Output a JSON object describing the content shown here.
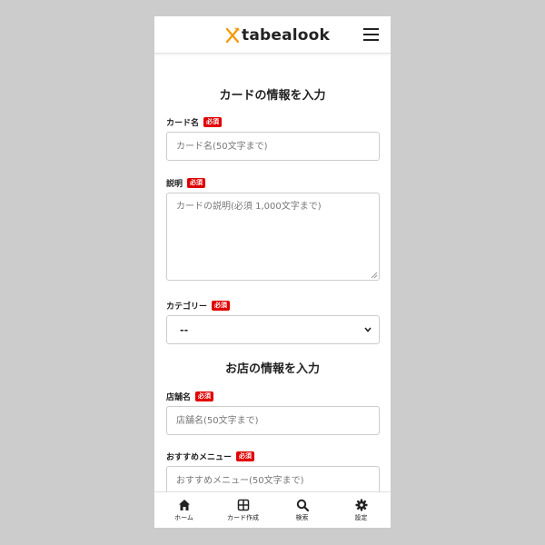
{
  "header": {
    "logo_text": "tabealook",
    "logo_icon": "fork-knife-icon",
    "menu_icon": "hamburger-menu-icon"
  },
  "card_section": {
    "title": "カードの情報を入力",
    "required_badge": "必須",
    "card_name": {
      "label": "カード名",
      "placeholder": "カード名(50文字まで)",
      "value": ""
    },
    "description": {
      "label": "説明",
      "placeholder": "カードの説明(必須 1,000文字まで)",
      "value": ""
    },
    "category": {
      "label": "カテゴリー",
      "selected": "--"
    }
  },
  "shop_section": {
    "title": "お店の情報を入力",
    "required_badge": "必須",
    "shop_name": {
      "label": "店舗名",
      "placeholder": "店舗名(50文字まで)",
      "value": ""
    },
    "recommended_menu": {
      "label": "おすすめメニュー",
      "placeholder": "おすすめメニュー(50文字まで)",
      "value": ""
    }
  },
  "bottom_nav": [
    {
      "label": "ホーム",
      "icon": "home-icon"
    },
    {
      "label": "カード作成",
      "icon": "grid-icon"
    },
    {
      "label": "検索",
      "icon": "search-icon"
    },
    {
      "label": "設定",
      "icon": "gear-icon"
    }
  ],
  "colors": {
    "background": "#cccccc",
    "required_badge": "#e00000",
    "logo_accent": "#f39800"
  }
}
